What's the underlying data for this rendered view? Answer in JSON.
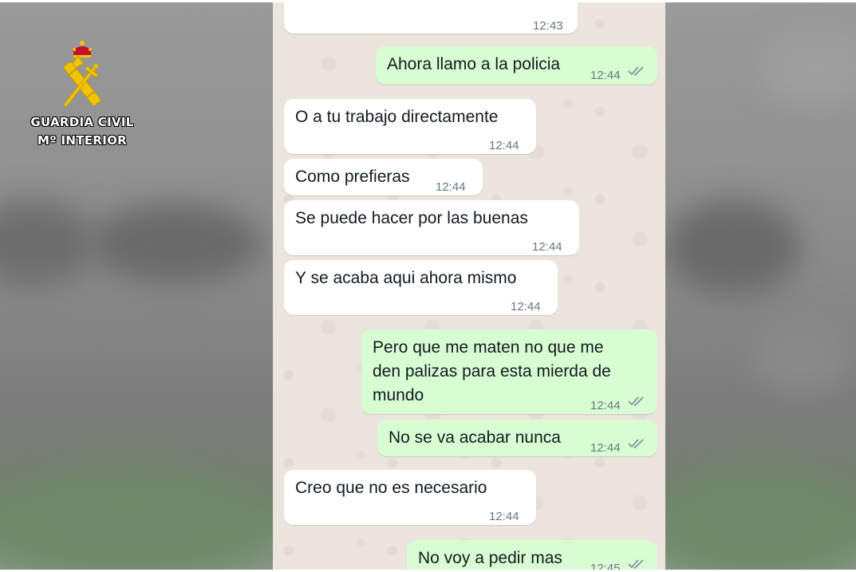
{
  "emblem": {
    "line1": "GUARDIA CIVIL",
    "line2": "Mº INTERIOR"
  },
  "messages": [
    {
      "dir": "in",
      "text": "",
      "time": "12:43"
    },
    {
      "dir": "out",
      "text": "Ahora llamo a la policia",
      "time": "12:44",
      "status": "read-double-check"
    },
    {
      "dir": "in",
      "text": "O a tu trabajo directamente",
      "time": "12:44"
    },
    {
      "dir": "in",
      "text": "Como prefieras",
      "time": "12:44"
    },
    {
      "dir": "in",
      "text": "Se puede hacer por las buenas",
      "time": "12:44"
    },
    {
      "dir": "in",
      "text": "Y se acaba aqui ahora mismo",
      "time": "12:44"
    },
    {
      "dir": "out",
      "text": "Pero que me maten no que me\nden palizas para esta mierda de\nmundo",
      "time": "12:44",
      "status": "read-double-check"
    },
    {
      "dir": "out",
      "text": "No se va acabar nunca",
      "time": "12:44",
      "status": "read-double-check"
    },
    {
      "dir": "in",
      "text": "Creo que no es necesario",
      "time": "12:44"
    },
    {
      "dir": "out",
      "text": "No voy a pedir mas",
      "time": "12:45",
      "status": "read-double-check"
    }
  ],
  "colors": {
    "incoming_bubble": "#ffffff",
    "outgoing_bubble": "#d9fdd3",
    "chat_background": "#ece5dd",
    "timestamp": "#667781"
  }
}
